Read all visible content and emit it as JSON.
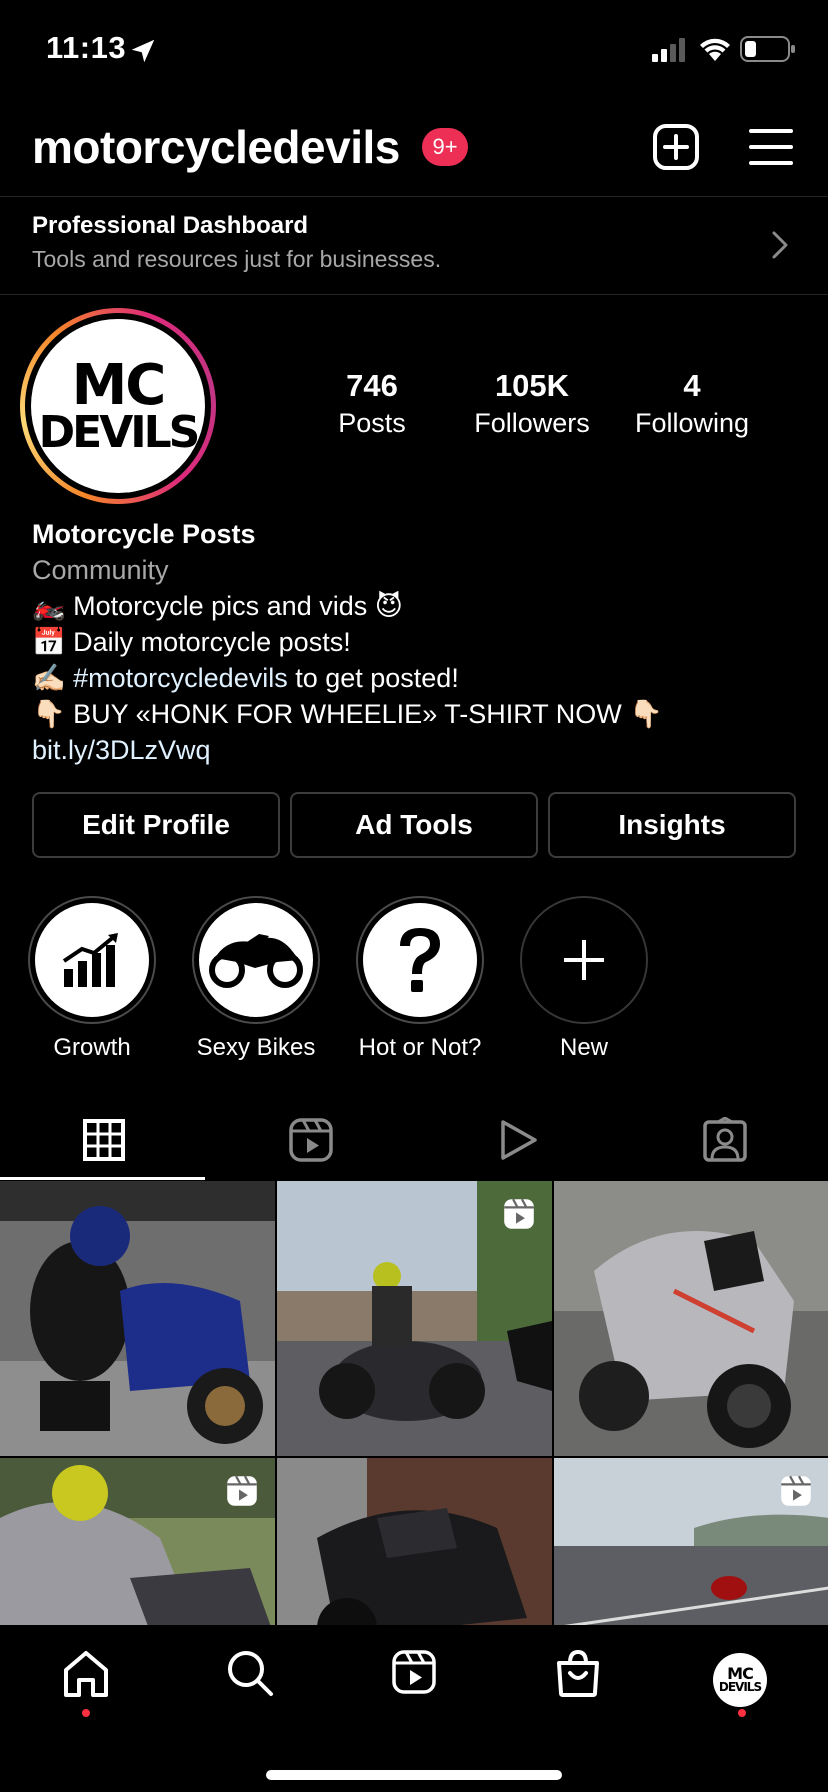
{
  "status_bar": {
    "time": "11:13"
  },
  "header": {
    "username": "motorcycledevils",
    "notification_badge": "9+"
  },
  "dashboard": {
    "title": "Professional Dashboard",
    "subtitle": "Tools and resources just for businesses."
  },
  "profile": {
    "avatar_text_line1": "MC",
    "avatar_text_line2": "DEVILS",
    "stats": [
      {
        "value": "746",
        "label": "Posts"
      },
      {
        "value": "105K",
        "label": "Followers"
      },
      {
        "value": "4",
        "label": "Following"
      }
    ],
    "name": "Motorcycle Posts",
    "category": "Community",
    "bio_line1": "🏍️ Motorcycle pics and vids 😈",
    "bio_line2": "📅 Daily motorcycle posts!",
    "bio_line3_prefix": "✍🏻 ",
    "bio_line3_hashtag": "#motorcycledevils",
    "bio_line3_suffix": " to get posted!",
    "bio_line4": "👇🏻  BUY «HONK FOR WHEELIE» T-SHIRT NOW 👇🏻",
    "link": "bit.ly/3DLzVwq"
  },
  "actions": {
    "edit_profile": "Edit Profile",
    "ad_tools": "Ad Tools",
    "insights": "Insights"
  },
  "highlights": [
    {
      "label": "Growth",
      "icon": "growth-chart-icon"
    },
    {
      "label": "Sexy Bikes",
      "icon": "motorcycle-icon"
    },
    {
      "label": "Hot or Not?",
      "icon": "question-mark-icon"
    },
    {
      "label": "New",
      "icon": "plus-icon"
    }
  ],
  "tabs": [
    {
      "name": "posts-grid",
      "icon": "grid-icon",
      "active": true
    },
    {
      "name": "reels",
      "icon": "reels-icon",
      "active": false
    },
    {
      "name": "videos",
      "icon": "play-icon",
      "active": false
    },
    {
      "name": "tagged",
      "icon": "tagged-person-icon",
      "active": false
    }
  ],
  "grid_posts": [
    {
      "description": "rider kneeling next to blue sport bike",
      "is_reel": false
    },
    {
      "description": "rider on sport bike in parking lot",
      "is_reel": true
    },
    {
      "description": "grey sport bike against concrete wall",
      "is_reel": false
    },
    {
      "description": "rider leaning on bike",
      "is_reel": true
    },
    {
      "description": "black ninja sport bike",
      "is_reel": false
    },
    {
      "description": "rider on highway by sea",
      "is_reel": true
    }
  ],
  "bottom_nav": {
    "items": [
      "home-icon",
      "search-icon",
      "reels-icon",
      "shop-icon",
      "profile-avatar"
    ],
    "avatar_text_line1": "MC",
    "avatar_text_line2": "DEVILS"
  },
  "colors": {
    "background": "#000000",
    "badge": "#ed2f55",
    "link": "#e0f1ff",
    "secondary_text": "#a8a8a8",
    "notification_dot": "#ff3040"
  }
}
